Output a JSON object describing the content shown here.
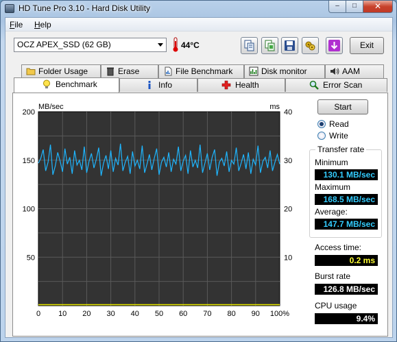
{
  "window": {
    "title": "HD Tune Pro 3.10 - Hard Disk Utility",
    "controls": {
      "minimize": "–",
      "maximize": "□",
      "close": "✕"
    }
  },
  "menu": [
    "File",
    "Help"
  ],
  "toolbar": {
    "drive": "OCZ APEX_SSD (62 GB)",
    "temperature": "44°C",
    "exit_label": "Exit",
    "buttons": [
      "copy-info-icon",
      "copy-screenshot-icon",
      "save-icon",
      "options-icon",
      "down-arrow-icon"
    ]
  },
  "tabs_row1": [
    "Folder Usage",
    "Erase",
    "File Benchmark",
    "Disk monitor",
    "AAM"
  ],
  "tabs_row2": [
    "Benchmark",
    "Info",
    "Health",
    "Error Scan"
  ],
  "active_tab": "Benchmark",
  "controls": {
    "start_label": "Start",
    "read_label": "Read",
    "write_label": "Write",
    "selected_mode": "Read"
  },
  "stats": {
    "transfer_rate_title": "Transfer rate",
    "minimum_label": "Minimum",
    "minimum_value": "130.1 MB/sec",
    "maximum_label": "Maximum",
    "maximum_value": "168.5 MB/sec",
    "average_label": "Average:",
    "average_value": "147.7 MB/sec",
    "access_label": "Access time:",
    "access_value": "0.2 ms",
    "burst_label": "Burst rate",
    "burst_value": "126.8 MB/sec",
    "cpu_label": "CPU usage",
    "cpu_value": "9.4%"
  },
  "colors": {
    "transfer_line": "#1fb6ff",
    "access_line": "#e6e600",
    "chart_bg": "#333333",
    "grid": "#5a5a5a"
  },
  "chart_data": {
    "type": "line",
    "left_unit": "MB/sec",
    "right_unit": "ms",
    "x_ticks": [
      "0",
      "10",
      "20",
      "30",
      "40",
      "50",
      "60",
      "70",
      "80",
      "90",
      "100%"
    ],
    "left_ticks": [
      "200",
      "150",
      "100",
      "50"
    ],
    "right_ticks": [
      "40",
      "30",
      "20",
      "10"
    ],
    "xlim": [
      0,
      100
    ],
    "ylim_left": [
      0,
      200
    ],
    "ylim_right": [
      0,
      40
    ],
    "series": [
      {
        "name": "Transfer rate",
        "x": [
          0,
          1,
          2,
          3,
          4,
          5,
          6,
          7,
          8,
          9,
          10,
          11,
          12,
          13,
          14,
          15,
          16,
          17,
          18,
          19,
          20,
          21,
          22,
          23,
          24,
          25,
          26,
          27,
          28,
          29,
          30,
          31,
          32,
          33,
          34,
          35,
          36,
          37,
          38,
          39,
          40,
          41,
          42,
          43,
          44,
          45,
          46,
          47,
          48,
          49,
          50,
          51,
          52,
          53,
          54,
          55,
          56,
          57,
          58,
          59,
          60,
          61,
          62,
          63,
          64,
          65,
          66,
          67,
          68,
          69,
          70,
          71,
          72,
          73,
          74,
          75,
          76,
          77,
          78,
          79,
          80,
          81,
          82,
          83,
          84,
          85,
          86,
          87,
          88,
          89,
          90,
          91,
          92,
          93,
          94,
          95,
          96,
          97,
          98,
          99,
          100
        ],
        "values": [
          147,
          152,
          161,
          139,
          148,
          166,
          135,
          144,
          158,
          149,
          138,
          162,
          146,
          153,
          136,
          160,
          145,
          150,
          140,
          164,
          137,
          149,
          157,
          142,
          151,
          163,
          134,
          147,
          155,
          141,
          160,
          138,
          152,
          145,
          167,
          139,
          148,
          154,
          136,
          159,
          144,
          150,
          141,
          165,
          137,
          146,
          156,
          140,
          152,
          162,
          135,
          148,
          153,
          143,
          158,
          138,
          151,
          146,
          164,
          139,
          149,
          155,
          136,
          160,
          143,
          150,
          142,
          166,
          137,
          147,
          157,
          140,
          153,
          161,
          134,
          148,
          152,
          144,
          159,
          138,
          150,
          146,
          163,
          139,
          147,
          156,
          141,
          158,
          136,
          151,
          145,
          165,
          137,
          149,
          153,
          142,
          160,
          139,
          148,
          156,
          146
        ]
      },
      {
        "name": "Access time",
        "x": [
          0,
          100
        ],
        "values": [
          0.2,
          0.2
        ]
      }
    ]
  }
}
